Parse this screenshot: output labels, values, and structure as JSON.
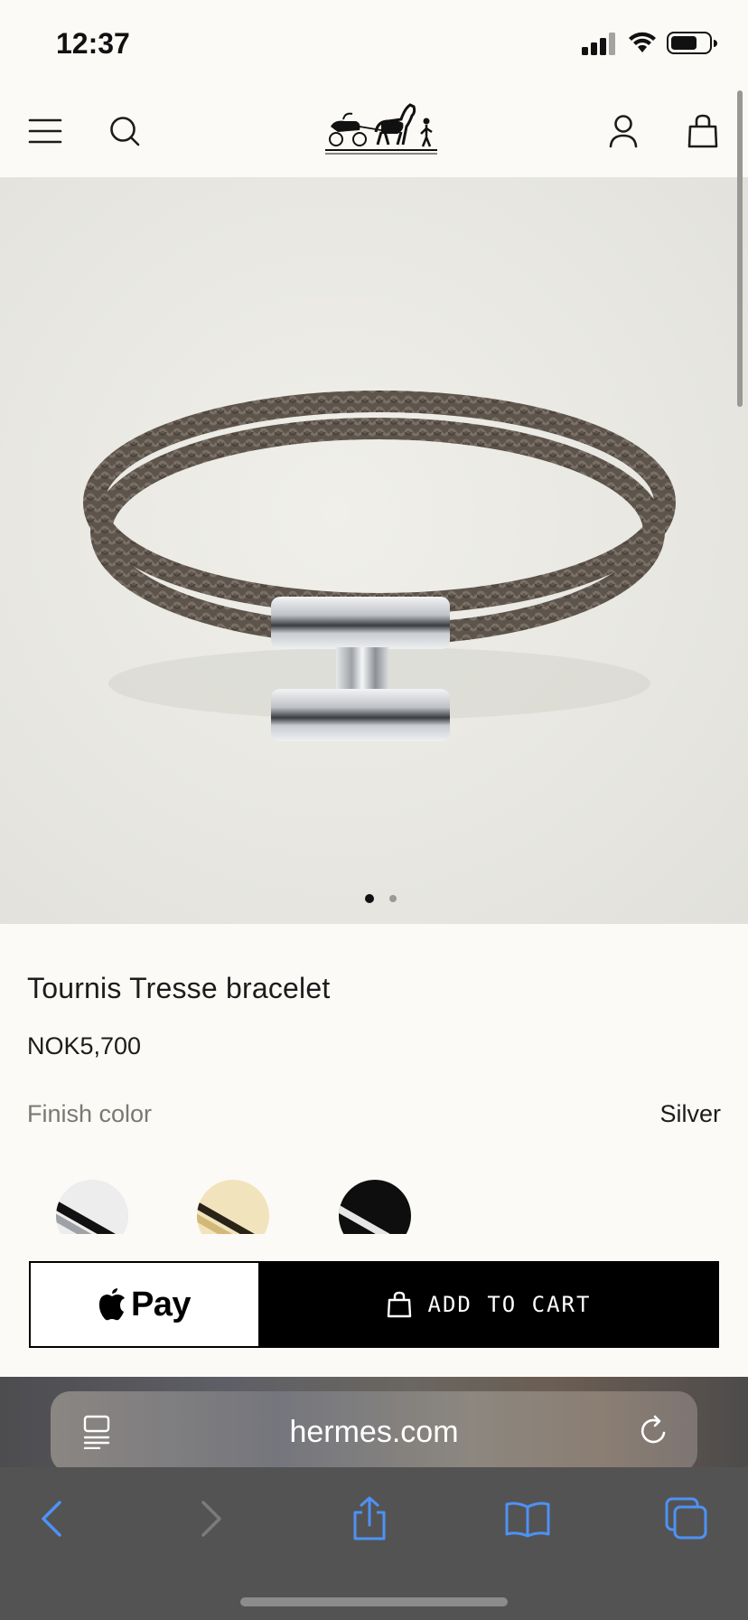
{
  "status_bar": {
    "time": "12:37",
    "icons": [
      "cellular-signal-icon",
      "wifi-icon",
      "battery-icon"
    ]
  },
  "header": {
    "icons": [
      "menu-icon",
      "search-icon",
      "hermes-logo",
      "account-icon",
      "shopping-bag-icon"
    ]
  },
  "product": {
    "image_description_icon": "braided-leather-bracelet-image",
    "carousel_count": 2,
    "carousel_active": 0,
    "title": "Tournis Tresse bracelet",
    "price": "NOK5,700",
    "finish_label": "Finish color",
    "finish_value": "Silver",
    "swatches": [
      {
        "name": "silver",
        "color": "#dcdcdc"
      },
      {
        "name": "gold",
        "color": "#e9d9a6"
      },
      {
        "name": "black",
        "color": "#111111"
      }
    ]
  },
  "cta": {
    "apple_pay_label": "Pay",
    "add_to_cart_label": "ADD TO CART"
  },
  "safari": {
    "url": "hermes.com",
    "toolbar_icons": [
      "back-icon",
      "forward-icon",
      "share-icon",
      "bookmarks-icon",
      "tabs-icon"
    ]
  },
  "colors": {
    "background": "#fcfaf6",
    "accent": "#000000",
    "safari_blue": "#3d86f2"
  }
}
